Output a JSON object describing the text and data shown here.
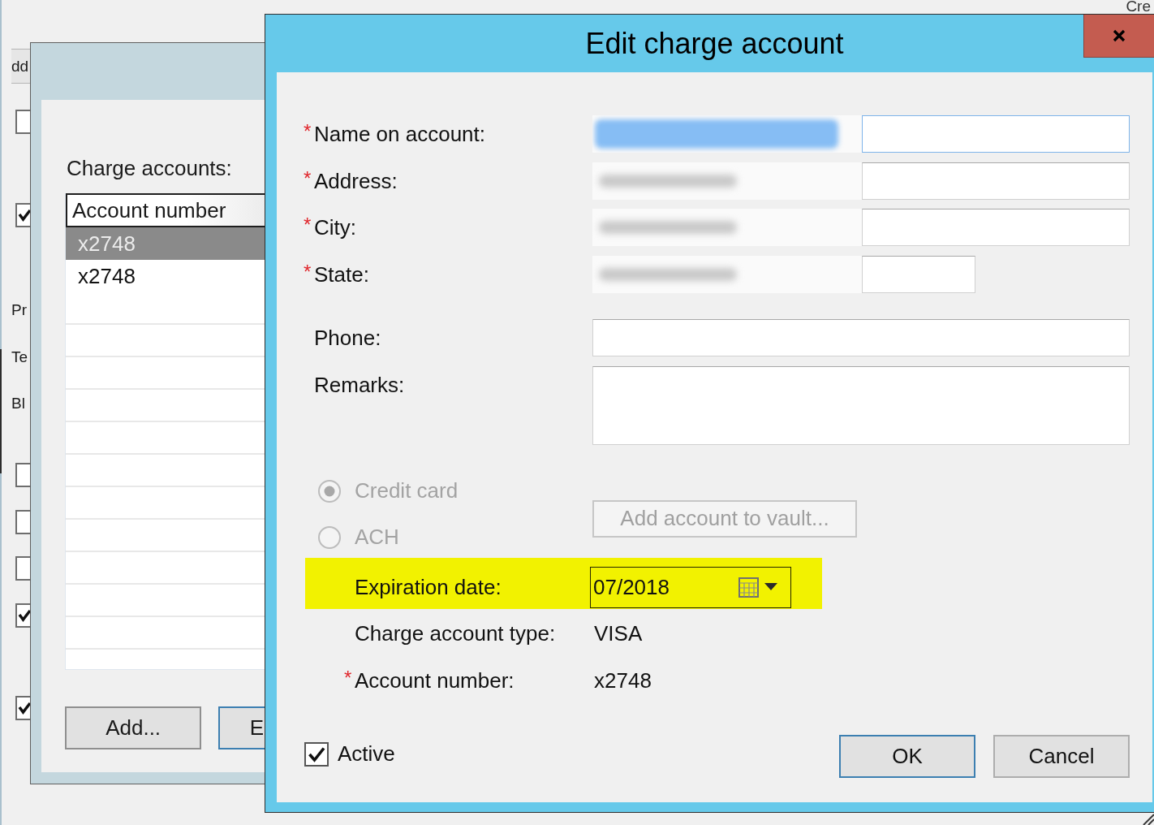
{
  "background_window": {
    "button": "dd",
    "items": [
      {
        "kind": "checkbox",
        "checked": false
      },
      {
        "kind": "checkbox",
        "checked": true
      },
      {
        "kind": "label",
        "text": "Pr"
      },
      {
        "kind": "label",
        "text": "Te"
      },
      {
        "kind": "label",
        "text": "Bl"
      },
      {
        "kind": "checkbox",
        "checked": false
      },
      {
        "kind": "checkbox",
        "checked": false
      },
      {
        "kind": "checkbox",
        "checked": false
      },
      {
        "kind": "checkbox",
        "checked": true
      },
      {
        "kind": "checkbox",
        "checked": true
      }
    ],
    "corner_text": "Cre"
  },
  "accounts_window": {
    "list_label": "Charge accounts:",
    "table": {
      "columns": [
        "Account number"
      ],
      "rows": [
        {
          "cells": [
            "x2748"
          ],
          "selected": true
        },
        {
          "cells": [
            "x2748"
          ],
          "selected": false
        }
      ]
    },
    "buttons": [
      {
        "label": "Add...",
        "default": false
      },
      {
        "label": "E",
        "default": true
      }
    ]
  },
  "dialog": {
    "title": "Edit charge account",
    "field_groups": [
      {
        "fields": [
          {
            "required_mark": "*",
            "label": "Name on account:",
            "kind": "text",
            "focused": true,
            "blurred": true
          },
          {
            "required_mark": "*",
            "label": "Address:",
            "kind": "text",
            "focused": false,
            "blurred": true
          },
          {
            "required_mark": "*",
            "label": "City:",
            "kind": "text",
            "focused": false,
            "blurred": true
          },
          {
            "required_mark": "*",
            "label": "State:",
            "kind": "short",
            "focused": false,
            "blurred": true
          }
        ]
      },
      {
        "fields": [
          {
            "label": "Phone:",
            "kind": "text",
            "focused": false,
            "blurred": false
          },
          {
            "label": "Remarks:",
            "kind": "textarea",
            "focused": false,
            "blurred": false
          }
        ]
      }
    ],
    "payment_types": [
      {
        "label": "Credit card",
        "selected": true,
        "disabled": true
      },
      {
        "label": "ACH",
        "selected": false,
        "disabled": true
      }
    ],
    "vault_button": {
      "label": "Add account to vault...",
      "disabled": true
    },
    "expiration": {
      "label": "Expiration date:",
      "value": "07/2018",
      "highlighted": true
    },
    "details": [
      {
        "label": "Charge account type:",
        "value": "VISA"
      },
      {
        "required_mark": "*",
        "label": "Account number:",
        "value": "x2748"
      }
    ],
    "active": {
      "label": "Active",
      "checked": true
    },
    "buttons": [
      {
        "label": "OK",
        "default": true
      },
      {
        "label": "Cancel",
        "default": false
      }
    ]
  }
}
